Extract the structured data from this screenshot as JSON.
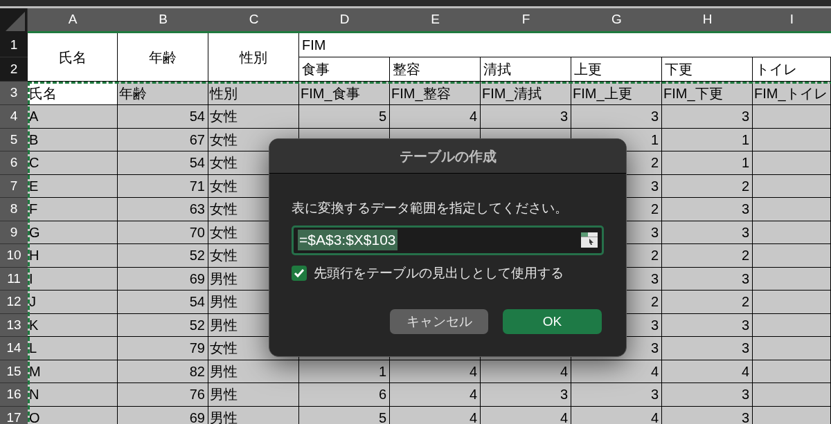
{
  "column_headers": [
    "A",
    "B",
    "C",
    "D",
    "E",
    "F",
    "G",
    "H",
    "I"
  ],
  "row_headers": [
    {
      "label": "1",
      "in_range": false
    },
    {
      "label": "2",
      "in_range": false
    },
    {
      "label": "3",
      "in_range": true
    },
    {
      "label": "4",
      "in_range": true
    },
    {
      "label": "5",
      "in_range": true
    },
    {
      "label": "6",
      "in_range": true
    },
    {
      "label": "7",
      "in_range": true
    },
    {
      "label": "8",
      "in_range": true
    },
    {
      "label": "9",
      "in_range": true
    },
    {
      "label": "10",
      "in_range": true
    },
    {
      "label": "11",
      "in_range": true
    },
    {
      "label": "12",
      "in_range": true
    },
    {
      "label": "13",
      "in_range": true
    },
    {
      "label": "14",
      "in_range": true
    },
    {
      "label": "15",
      "in_range": true
    },
    {
      "label": "16",
      "in_range": true
    },
    {
      "label": "17",
      "in_range": true
    }
  ],
  "header_block": {
    "merged_labels": [
      "氏名",
      "年齢",
      "性別"
    ],
    "group_label": "FIM",
    "sub_labels": [
      "食事",
      "整容",
      "清拭",
      "上更",
      "下更",
      "トイレ"
    ]
  },
  "table": {
    "columns": [
      {
        "label": "氏名",
        "kind": "text",
        "selected": true
      },
      {
        "label": "年齢",
        "kind": "number",
        "selected": false
      },
      {
        "label": "性別",
        "kind": "text",
        "selected": false
      },
      {
        "label": "FIM_食事",
        "kind": "number",
        "selected": false
      },
      {
        "label": "FIM_整容",
        "kind": "number",
        "selected": false
      },
      {
        "label": "FIM_清拭",
        "kind": "number",
        "selected": false
      },
      {
        "label": "FIM_上更",
        "kind": "number",
        "selected": false
      },
      {
        "label": "FIM_下更",
        "kind": "number",
        "selected": false
      },
      {
        "label": "FIM_トイレ",
        "kind": "number",
        "selected": false
      }
    ],
    "rows": [
      {
        "cells": [
          "A",
          "54",
          "女性",
          "5",
          "4",
          "3",
          "3",
          "3"
        ]
      },
      {
        "cells": [
          "B",
          "67",
          "女性",
          null,
          null,
          null,
          "1",
          "1"
        ]
      },
      {
        "cells": [
          "C",
          "54",
          "女性",
          null,
          null,
          null,
          "2",
          "1"
        ]
      },
      {
        "cells": [
          "E",
          "71",
          "女性",
          null,
          null,
          null,
          "3",
          "2"
        ]
      },
      {
        "cells": [
          "F",
          "63",
          "女性",
          null,
          null,
          null,
          "2",
          "3"
        ]
      },
      {
        "cells": [
          "G",
          "70",
          "女性",
          null,
          null,
          null,
          "3",
          "3"
        ]
      },
      {
        "cells": [
          "H",
          "52",
          "女性",
          null,
          null,
          null,
          "2",
          "2"
        ]
      },
      {
        "cells": [
          "I",
          "69",
          "男性",
          null,
          null,
          null,
          "3",
          "3"
        ]
      },
      {
        "cells": [
          "J",
          "54",
          "男性",
          null,
          null,
          null,
          "2",
          "2"
        ]
      },
      {
        "cells": [
          "K",
          "52",
          "男性",
          null,
          null,
          null,
          "3",
          "3"
        ]
      },
      {
        "cells": [
          "L",
          "79",
          "女性",
          null,
          null,
          null,
          "3",
          "3"
        ]
      },
      {
        "cells": [
          "M",
          "82",
          "男性",
          "1",
          "4",
          "4",
          "4",
          "4"
        ]
      },
      {
        "cells": [
          "N",
          "76",
          "男性",
          "6",
          "4",
          "3",
          "3",
          "3"
        ]
      },
      {
        "cells": [
          "O",
          "69",
          "男性",
          "5",
          "4",
          "4",
          "4",
          "3"
        ]
      }
    ]
  },
  "dialog": {
    "title": "テーブルの作成",
    "prompt": "表に変換するデータ範囲を指定してください。",
    "range_field": {
      "value": "=$A$3:$X$103"
    },
    "checkbox": {
      "label": "先頭行をテーブルの見出しとして使用する",
      "checked": true
    },
    "buttons": [
      {
        "label": "キャンセル",
        "kind": "cancel"
      },
      {
        "label": "OK",
        "kind": "default"
      }
    ]
  }
}
